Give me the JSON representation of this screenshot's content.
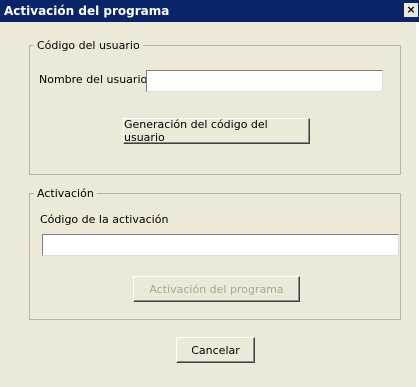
{
  "window": {
    "title": "Activación del programa",
    "close_glyph": "×"
  },
  "user_code": {
    "legend": "Código del usuario",
    "username_label": "Nombre del usuario",
    "username_value": "",
    "generate_button": "Generación del código del usuario"
  },
  "activation": {
    "legend": "Activación",
    "code_label": "Código de la activación",
    "code_value": "",
    "activate_button": "Activación del programa",
    "activate_enabled": false
  },
  "footer": {
    "cancel_button": "Cancelar"
  },
  "colors": {
    "titlebar": "#0a246a",
    "face": "#ece9d8",
    "disabled_text": "#a8a89a"
  }
}
